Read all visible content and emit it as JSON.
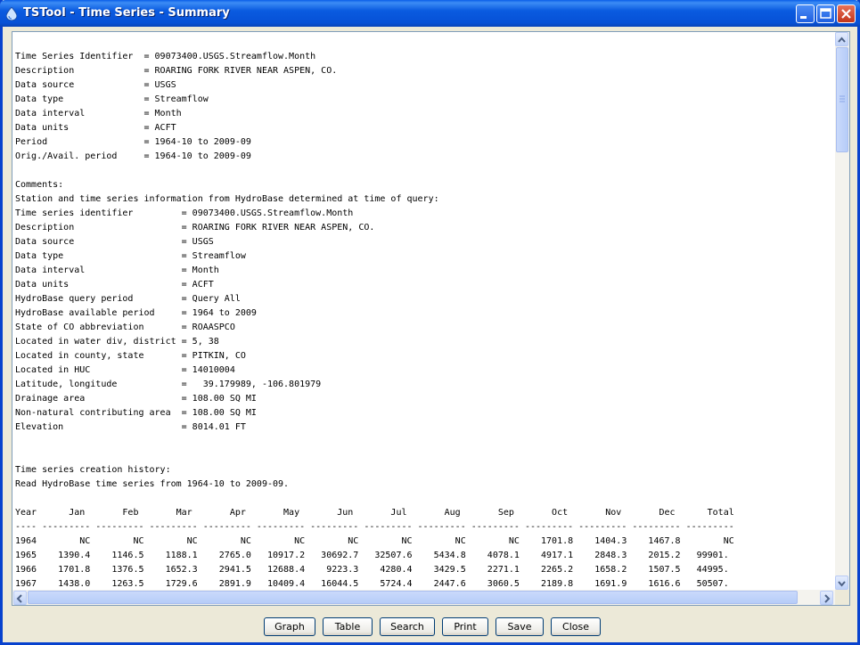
{
  "window": {
    "title": "TSTool - Time Series - Summary",
    "app_icon": "water-drop-icon",
    "controls": [
      "minimize-icon",
      "maximize-icon",
      "close-icon"
    ]
  },
  "summary": {
    "header_lines": [
      "Time Series Identifier  = 09073400.USGS.Streamflow.Month",
      "Description             = ROARING FORK RIVER NEAR ASPEN, CO.",
      "Data source             = USGS",
      "Data type               = Streamflow",
      "Data interval           = Month",
      "Data units              = ACFT",
      "Period                  = 1964-10 to 2009-09",
      "Orig./Avail. period     = 1964-10 to 2009-09",
      "",
      "Comments:",
      "Station and time series information from HydroBase determined at time of query:",
      "Time series identifier         = 09073400.USGS.Streamflow.Month",
      "Description                    = ROARING FORK RIVER NEAR ASPEN, CO.",
      "Data source                    = USGS",
      "Data type                      = Streamflow",
      "Data interval                  = Month",
      "Data units                     = ACFT",
      "HydroBase query period         = Query All",
      "HydroBase available period     = 1964 to 2009",
      "State of CO abbreviation       = ROAASPCO",
      "Located in water div, district = 5, 38",
      "Located in county, state       = PITKIN, CO",
      "Located in HUC                 = 14010004",
      "Latitude, longitude            =   39.179989, -106.801979",
      "Drainage area                  = 108.00 SQ MI",
      "Non-natural contributing area  = 108.00 SQ MI",
      "Elevation                      = 8014.01 FT",
      "",
      "",
      "Time series creation history:",
      "Read HydroBase time series from 1964-10 to 2009-09.",
      ""
    ],
    "table_lines": [
      "Year      Jan       Feb       Mar       Apr       May       Jun       Jul       Aug       Sep       Oct       Nov       Dec      Total",
      "---- --------- --------- --------- --------- --------- --------- --------- --------- --------- --------- --------- --------- ---------",
      "1964        NC        NC        NC        NC        NC        NC        NC        NC        NC    1701.8    1404.3    1467.8        NC",
      "1965    1390.4    1146.5    1188.1    2765.0   10917.2   30692.7   32507.6    5434.8    4078.1    4917.1    2848.3    2015.2   99901.",
      "1966    1701.8    1376.5    1652.3    2941.5   12688.4    9223.3    4280.4    3429.5    2271.1    2265.2    1658.2    1507.5   44995.",
      "1967    1438.0    1263.5    1729.6    2891.9   10409.4   16044.5    5724.4    2447.6    3060.5    2189.8    1691.9    1616.6   50507."
    ]
  },
  "buttons": {
    "graph": "Graph",
    "table": "Table",
    "search": "Search",
    "print": "Print",
    "save": "Save",
    "close": "Close"
  }
}
